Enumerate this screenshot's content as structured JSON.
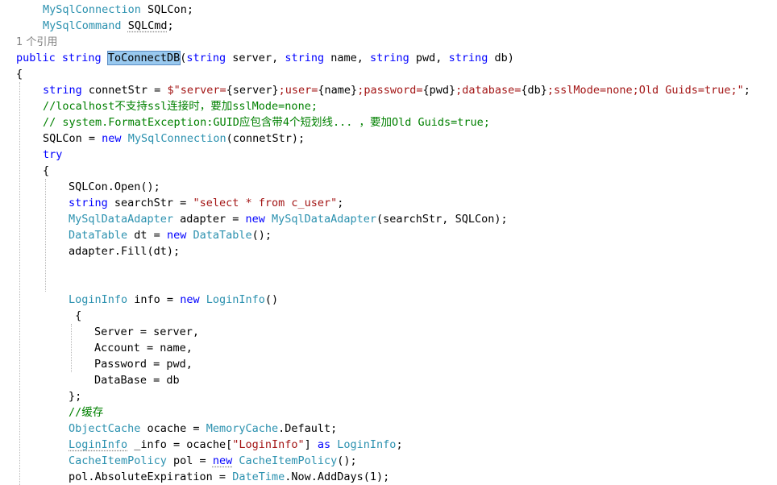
{
  "editor": {
    "colors": {
      "background": "#ffffff",
      "keyword": "#0000ff",
      "type": "#2b91af",
      "string": "#a31515",
      "comment": "#008000",
      "plain": "#000000",
      "codelens": "#808080",
      "highlight": "#99c9ef"
    },
    "lines": [
      {
        "indent": 1,
        "tokens": [
          {
            "t": "MySqlConnection",
            "c": "type"
          },
          {
            "t": " SQLCon;",
            "c": "plain"
          }
        ]
      },
      {
        "indent": 1,
        "tokens": [
          {
            "t": "MySqlCommand",
            "c": "type"
          },
          {
            "t": " ",
            "c": "plain"
          },
          {
            "t": "SQLCmd",
            "c": "plain",
            "squiggle": true
          },
          {
            "t": ";",
            "c": "plain"
          }
        ]
      },
      {
        "indent": 0,
        "tokens": [
          {
            "t": "1 个引用",
            "c": "ref"
          }
        ]
      },
      {
        "indent": 0,
        "tokens": [
          {
            "t": "public",
            "c": "kw"
          },
          {
            "t": " ",
            "c": "plain"
          },
          {
            "t": "string",
            "c": "kw"
          },
          {
            "t": " ",
            "c": "plain"
          },
          {
            "t": "ToConnectDB",
            "c": "plain",
            "highlight": true
          },
          {
            "t": "(",
            "c": "plain"
          },
          {
            "t": "string",
            "c": "kw"
          },
          {
            "t": " server, ",
            "c": "plain"
          },
          {
            "t": "string",
            "c": "kw"
          },
          {
            "t": " name, ",
            "c": "plain"
          },
          {
            "t": "string",
            "c": "kw"
          },
          {
            "t": " pwd, ",
            "c": "plain"
          },
          {
            "t": "string",
            "c": "kw"
          },
          {
            "t": " db)",
            "c": "plain"
          }
        ]
      },
      {
        "indent": 0,
        "tokens": [
          {
            "t": "{",
            "c": "plain"
          }
        ]
      },
      {
        "indent": 1,
        "tokens": [
          {
            "t": "string",
            "c": "kw"
          },
          {
            "t": " connetStr = ",
            "c": "plain"
          },
          {
            "t": "$\"server=",
            "c": "str"
          },
          {
            "t": "{server}",
            "c": "plain"
          },
          {
            "t": ";user=",
            "c": "str"
          },
          {
            "t": "{name}",
            "c": "plain"
          },
          {
            "t": ";password=",
            "c": "str"
          },
          {
            "t": "{pwd}",
            "c": "plain"
          },
          {
            "t": ";database=",
            "c": "str"
          },
          {
            "t": "{db}",
            "c": "plain"
          },
          {
            "t": ";sslMode=none;Old Guids=true;\"",
            "c": "str"
          },
          {
            "t": ";",
            "c": "plain"
          }
        ]
      },
      {
        "indent": 1,
        "tokens": [
          {
            "t": "//localhost不支持ssl连接时，要加sslMode=none;",
            "c": "cmt"
          }
        ]
      },
      {
        "indent": 1,
        "tokens": [
          {
            "t": "// system.FormatException:GUID应包含带4个短划线... ，要加Old Guids=true;",
            "c": "cmt"
          }
        ]
      },
      {
        "indent": 1,
        "tokens": [
          {
            "t": "SQLCon = ",
            "c": "plain"
          },
          {
            "t": "new",
            "c": "kw"
          },
          {
            "t": " ",
            "c": "plain"
          },
          {
            "t": "MySqlConnection",
            "c": "type"
          },
          {
            "t": "(connetStr);",
            "c": "plain"
          }
        ]
      },
      {
        "indent": 1,
        "tokens": [
          {
            "t": "try",
            "c": "kw"
          }
        ]
      },
      {
        "indent": 1,
        "tokens": [
          {
            "t": "{",
            "c": "plain"
          }
        ]
      },
      {
        "indent": 2,
        "tokens": [
          {
            "t": "SQLCon.Open();",
            "c": "plain"
          }
        ]
      },
      {
        "indent": 2,
        "tokens": [
          {
            "t": "string",
            "c": "kw"
          },
          {
            "t": " searchStr = ",
            "c": "plain"
          },
          {
            "t": "\"select * from c_user\"",
            "c": "str"
          },
          {
            "t": ";",
            "c": "plain"
          }
        ]
      },
      {
        "indent": 2,
        "tokens": [
          {
            "t": "MySqlDataAdapter",
            "c": "type"
          },
          {
            "t": " adapter = ",
            "c": "plain"
          },
          {
            "t": "new",
            "c": "kw"
          },
          {
            "t": " ",
            "c": "plain"
          },
          {
            "t": "MySqlDataAdapter",
            "c": "type"
          },
          {
            "t": "(searchStr, SQLCon);",
            "c": "plain"
          }
        ]
      },
      {
        "indent": 2,
        "tokens": [
          {
            "t": "DataTable",
            "c": "type"
          },
          {
            "t": " dt = ",
            "c": "plain"
          },
          {
            "t": "new",
            "c": "kw"
          },
          {
            "t": " ",
            "c": "plain"
          },
          {
            "t": "DataTable",
            "c": "type"
          },
          {
            "t": "();",
            "c": "plain"
          }
        ]
      },
      {
        "indent": 2,
        "tokens": [
          {
            "t": "adapter.Fill(dt);",
            "c": "plain"
          }
        ]
      },
      {
        "indent": 2,
        "tokens": []
      },
      {
        "indent": 2,
        "tokens": []
      },
      {
        "indent": 2,
        "tokens": [
          {
            "t": "LoginInfo",
            "c": "type"
          },
          {
            "t": " info = ",
            "c": "plain"
          },
          {
            "t": "new",
            "c": "kw"
          },
          {
            "t": " ",
            "c": "plain"
          },
          {
            "t": "LoginInfo",
            "c": "type"
          },
          {
            "t": "()",
            "c": "plain"
          }
        ]
      },
      {
        "indent": 2,
        "tokens": [
          {
            "t": " {",
            "c": "plain"
          }
        ]
      },
      {
        "indent": 3,
        "tokens": [
          {
            "t": "Server = server,",
            "c": "plain"
          }
        ]
      },
      {
        "indent": 3,
        "tokens": [
          {
            "t": "Account = name,",
            "c": "plain"
          }
        ]
      },
      {
        "indent": 3,
        "tokens": [
          {
            "t": "Password = pwd,",
            "c": "plain"
          }
        ]
      },
      {
        "indent": 3,
        "tokens": [
          {
            "t": "DataBase = db",
            "c": "plain"
          }
        ]
      },
      {
        "indent": 2,
        "tokens": [
          {
            "t": "};",
            "c": "plain"
          }
        ]
      },
      {
        "indent": 2,
        "tokens": [
          {
            "t": "//缓存",
            "c": "cmt"
          }
        ]
      },
      {
        "indent": 2,
        "tokens": [
          {
            "t": "ObjectCache",
            "c": "type"
          },
          {
            "t": " ocache = ",
            "c": "plain"
          },
          {
            "t": "MemoryCache",
            "c": "type"
          },
          {
            "t": ".Default;",
            "c": "plain"
          }
        ]
      },
      {
        "indent": 2,
        "tokens": [
          {
            "t": "LoginInfo",
            "c": "type",
            "squiggle": true
          },
          {
            "t": " _info = ocache[",
            "c": "plain"
          },
          {
            "t": "\"LoginInfo\"",
            "c": "str"
          },
          {
            "t": "] ",
            "c": "plain"
          },
          {
            "t": "as",
            "c": "kw"
          },
          {
            "t": " ",
            "c": "plain"
          },
          {
            "t": "LoginInfo",
            "c": "type"
          },
          {
            "t": ";",
            "c": "plain"
          }
        ]
      },
      {
        "indent": 2,
        "tokens": [
          {
            "t": "CacheItemPolicy",
            "c": "type"
          },
          {
            "t": " pol = ",
            "c": "plain"
          },
          {
            "t": "new",
            "c": "kw",
            "squiggle": true
          },
          {
            "t": " ",
            "c": "plain"
          },
          {
            "t": "CacheItemPolicy",
            "c": "type"
          },
          {
            "t": "();",
            "c": "plain"
          }
        ]
      },
      {
        "indent": 2,
        "tokens": [
          {
            "t": "pol.AbsoluteExpiration = ",
            "c": "plain"
          },
          {
            "t": "DateTime",
            "c": "type"
          },
          {
            "t": ".Now.AddDays(1);",
            "c": "plain"
          }
        ]
      }
    ]
  }
}
